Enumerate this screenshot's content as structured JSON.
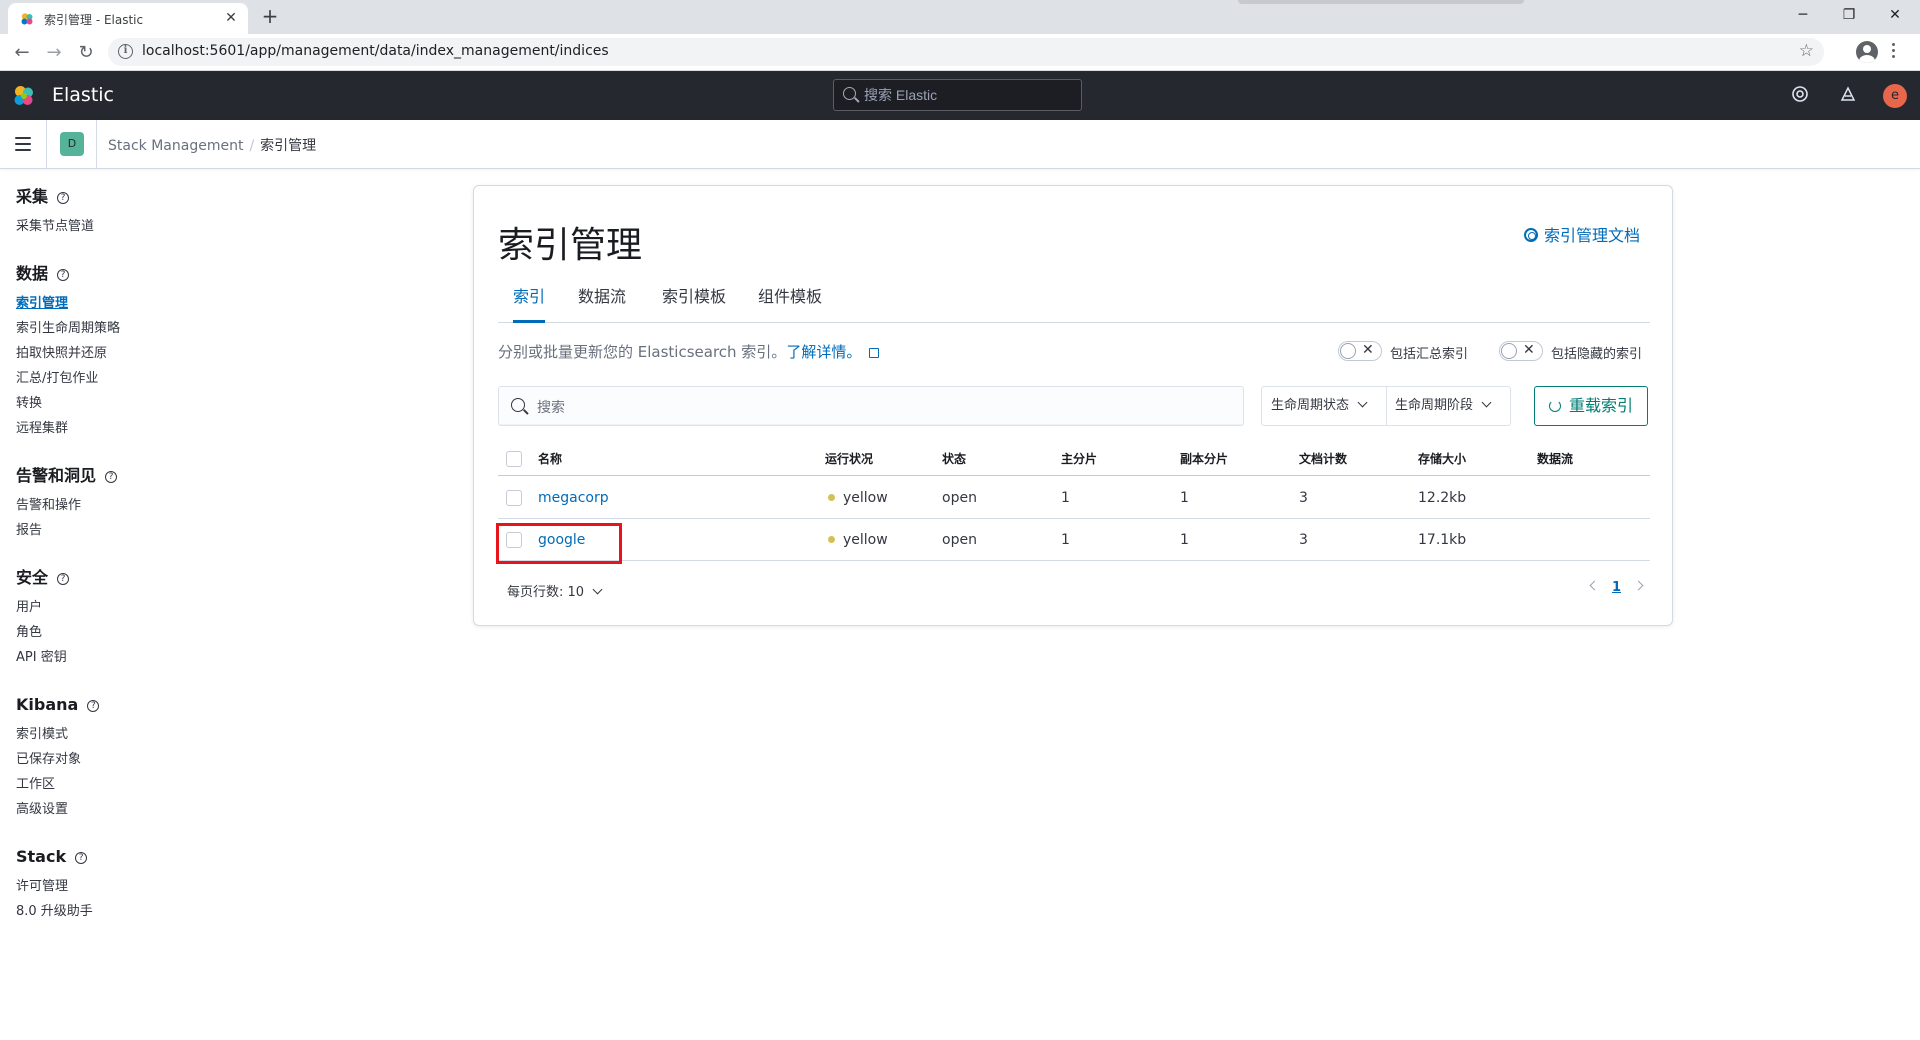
{
  "browser": {
    "tab_title": "索引管理 - Elastic",
    "tab_close": "✕",
    "new_tab": "+",
    "url": "localhost:5601/app/management/data/index_management/indices",
    "info_glyph": "i",
    "window_minimize": "─",
    "window_restore": "❐",
    "window_close": "✕",
    "back_glyph": "←",
    "forward_glyph": "→",
    "reload_glyph": "↻",
    "star_glyph": "☆"
  },
  "kibana_header": {
    "brand": "Elastic",
    "search_placeholder": "搜索 Elastic",
    "help_icon": "help-icon",
    "news_icon": "newsfeed-icon",
    "user_initial": "e"
  },
  "subheader": {
    "space_initial": "D",
    "breadcrumbs": [
      "Stack Management",
      "索引管理"
    ],
    "crumb_sep": "/"
  },
  "sidebar": {
    "help_glyph": "?",
    "groups": [
      {
        "title": "采集",
        "items": [
          "采集节点管道"
        ]
      },
      {
        "title": "数据",
        "items": [
          "索引管理",
          "索引生命周期策略",
          "拍取快照并还原",
          "汇总/打包作业",
          "转换",
          "远程集群"
        ]
      },
      {
        "title": "告警和洞见",
        "items": [
          "告警和操作",
          "报告"
        ]
      },
      {
        "title": "安全",
        "items": [
          "用户",
          "角色",
          "API 密钥"
        ]
      },
      {
        "title": "Kibana",
        "items": [
          "索引模式",
          "已保存对象",
          "工作区",
          "高级设置"
        ]
      },
      {
        "title": "Stack",
        "items": [
          "许可管理",
          "8.0 升级助手"
        ]
      }
    ],
    "active_item": "索引管理"
  },
  "main": {
    "title": "索引管理",
    "doc_link": "索引管理文档",
    "tabs": [
      "索引",
      "数据流",
      "索引模板",
      "组件模板"
    ],
    "selected_tab": "索引",
    "description": "分别或批量更新您的 Elasticsearch 索引。",
    "learn_more": "了解详情。",
    "toggles": {
      "include_rollup": "包括汇总索引",
      "include_hidden": "包括隐藏的索引",
      "off_glyph": "✕"
    },
    "search_placeholder": "搜索",
    "filters": {
      "lifecycle_status": "生命周期状态",
      "lifecycle_phase": "生命周期阶段"
    },
    "reload_button": "重载索引",
    "table": {
      "columns": [
        "名称",
        "运行状况",
        "状态",
        "主分片",
        "副本分片",
        "文档计数",
        "存储大小",
        "数据流"
      ],
      "rows": [
        {
          "name": "megacorp",
          "health": "yellow",
          "status": "open",
          "primary": "1",
          "replicas": "1",
          "docs": "3",
          "size": "12.2kb",
          "data_stream": ""
        },
        {
          "name": "google",
          "health": "yellow",
          "status": "open",
          "primary": "1",
          "replicas": "1",
          "docs": "3",
          "size": "17.1kb",
          "data_stream": ""
        }
      ],
      "health_color": "#d6bf57"
    },
    "rows_per_page": "每页行数: 10",
    "current_page": "1"
  },
  "colors": {
    "accent": "#006bb8",
    "success": "#017d73",
    "header_bg": "#25282f",
    "annotation": "#e8141b"
  }
}
